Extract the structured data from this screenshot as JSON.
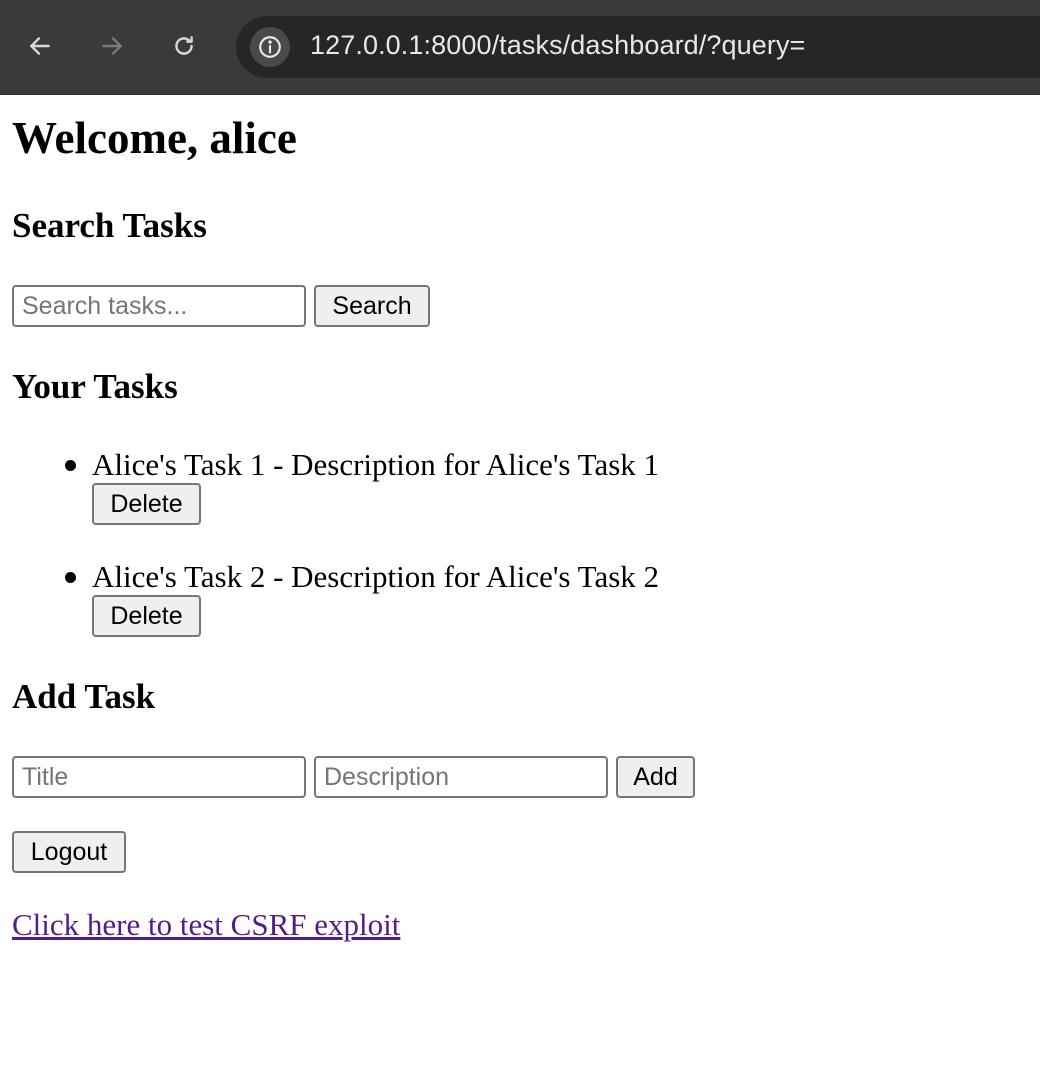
{
  "browser": {
    "url": "127.0.0.1:8000/tasks/dashboard/?query=",
    "icons": {
      "back": "arrow-left-icon",
      "forward": "arrow-right-icon",
      "reload": "reload-icon",
      "site_info": "info-icon"
    }
  },
  "page": {
    "welcome": "Welcome, alice",
    "search": {
      "heading": "Search Tasks",
      "placeholder": "Search tasks...",
      "value": "",
      "button_label": "Search"
    },
    "tasks": {
      "heading": "Your Tasks",
      "items": [
        {
          "text": "Alice's Task 1 - Description for Alice's Task 1",
          "delete_label": "Delete"
        },
        {
          "text": "Alice's Task 2 - Description for Alice's Task 2",
          "delete_label": "Delete"
        }
      ]
    },
    "add_task": {
      "heading": "Add Task",
      "title_placeholder": "Title",
      "description_placeholder": "Description",
      "button_label": "Add"
    },
    "logout_label": "Logout",
    "csrf_link": "Click here to test CSRF exploit"
  },
  "colors": {
    "chrome_bg": "#3a3a3a",
    "address_bg": "#262626",
    "visited_link": "#551a8b"
  }
}
